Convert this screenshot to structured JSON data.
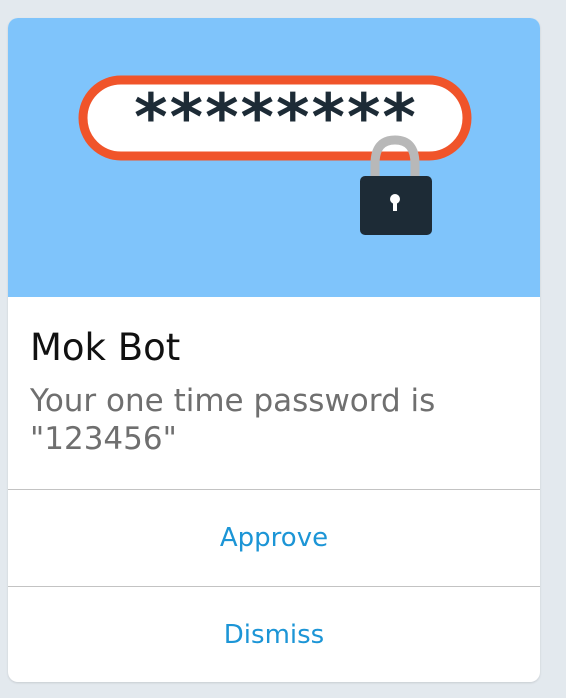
{
  "hero": {
    "icon": "password-lock-icon",
    "masked_password": "********",
    "colors": {
      "background": "#7fc4fb",
      "pill_border": "#f0542a",
      "lock_body": "#1d2b36",
      "shackle": "#b8b8b8"
    }
  },
  "notification": {
    "title": "Mok Bot",
    "message": "Your one time password is \"123456\""
  },
  "actions": {
    "approve_label": "Approve",
    "dismiss_label": "Dismiss"
  },
  "colors": {
    "action_text": "#1c95d6",
    "title_text": "#111111",
    "message_text": "#6f6f6f"
  }
}
